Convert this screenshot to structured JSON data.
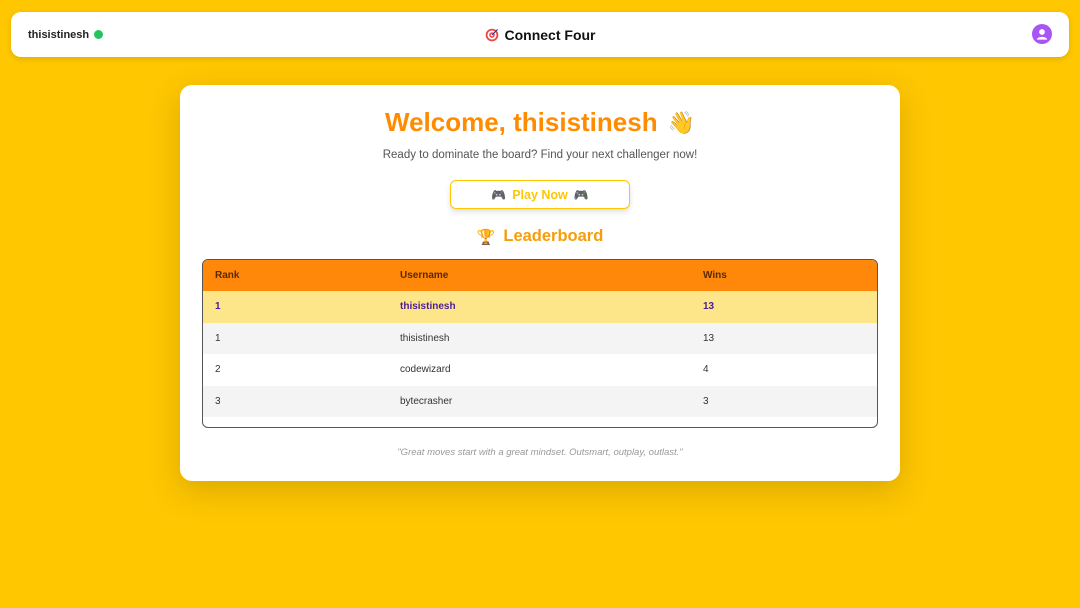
{
  "navbar": {
    "username": "thisistinesh",
    "status_color": "#22c55e",
    "title": "Connect Four",
    "title_icon": "target-icon",
    "avatar_icon": "user-avatar-icon"
  },
  "welcome": {
    "heading": "Welcome, thisistinesh",
    "heading_emoji": "👋",
    "subtitle": "Ready to dominate the board? Find your next challenger now!"
  },
  "play_button": {
    "label": "Play Now",
    "icon_left": "🎮",
    "icon_right": "🎮"
  },
  "leaderboard": {
    "title": "Leaderboard",
    "icon": "🏆",
    "columns": [
      "Rank",
      "Username",
      "Wins"
    ],
    "current_user_row": {
      "rank": "1",
      "username": "thisistinesh",
      "wins": "13"
    },
    "rows": [
      {
        "rank": "1",
        "username": "thisistinesh",
        "wins": "13"
      },
      {
        "rank": "2",
        "username": "codewizard",
        "wins": "4"
      },
      {
        "rank": "3",
        "username": "bytecrasher",
        "wins": "3"
      }
    ]
  },
  "quote": "\"Great moves start with a great mindset. Outsmart, outplay, outlast.\"",
  "colors": {
    "background": "#FEC700",
    "accent_orange": "#FF8C00",
    "header_orange": "#FF8709",
    "highlight_row": "#FDE68A",
    "avatar_purple": "#a855f7"
  }
}
